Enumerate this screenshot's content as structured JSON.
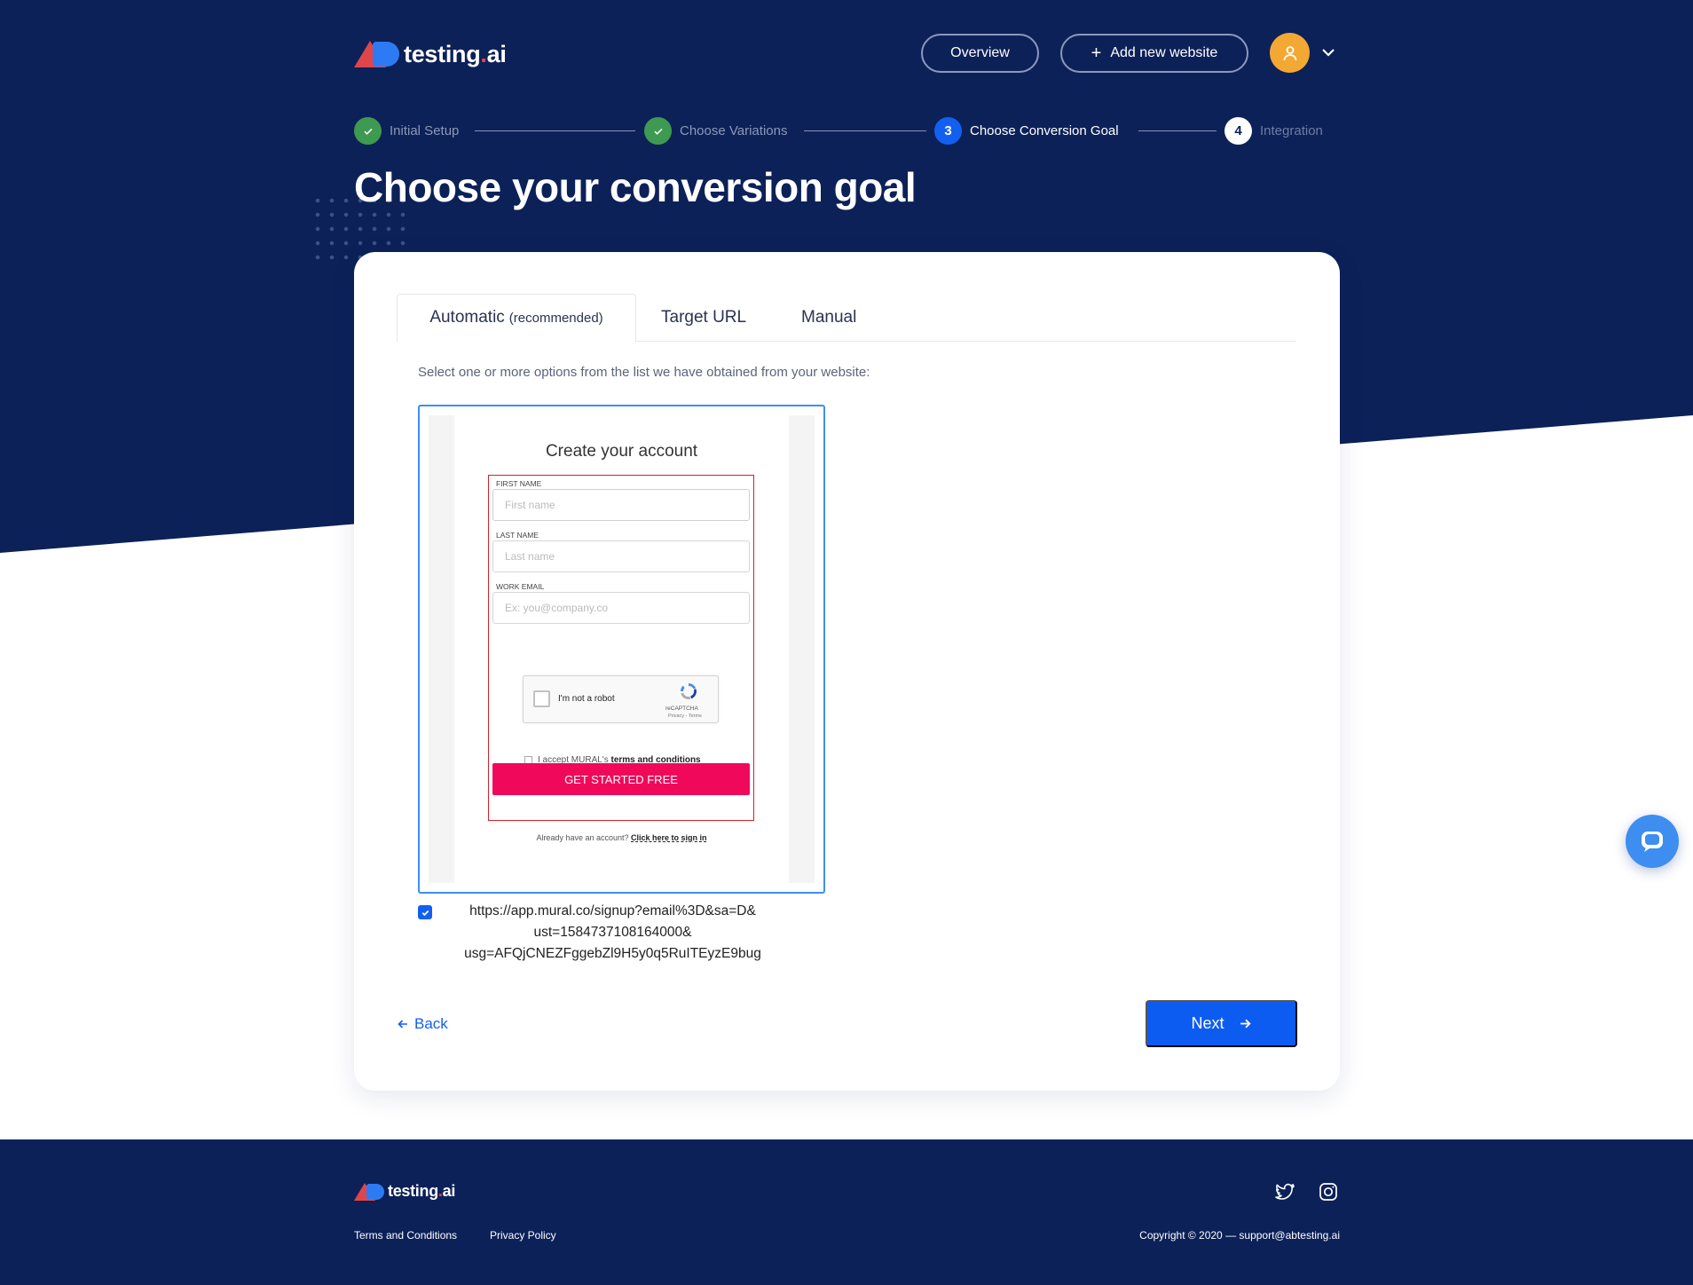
{
  "header": {
    "logo_text": "testing",
    "logo_dot": ".",
    "logo_suffix": "ai",
    "overview_label": "Overview",
    "add_site_label": "Add new website"
  },
  "stepper": {
    "steps": [
      {
        "label": "Initial Setup",
        "state": "done"
      },
      {
        "label": "Choose Variations",
        "state": "done"
      },
      {
        "label": "Choose Conversion Goal",
        "state": "active",
        "number": "3"
      },
      {
        "label": "Integration",
        "state": "todo",
        "number": "4"
      }
    ]
  },
  "page": {
    "title": "Choose your conversion goal"
  },
  "tabs": {
    "automatic_label": "Automatic",
    "automatic_hint": "(recommended)",
    "target_url_label": "Target URL",
    "manual_label": "Manual"
  },
  "instructions": "Select one or more options from the list we have obtained from your website:",
  "preview": {
    "title": "Create your account",
    "first_name_label": "FIRST NAME",
    "first_name_placeholder": "First name",
    "last_name_label": "LAST NAME",
    "last_name_placeholder": "Last name",
    "work_email_label": "WORK EMAIL",
    "work_email_placeholder": "Ex: you@company.co",
    "captcha_text": "I'm not a robot",
    "captcha_brand": "reCAPTCHA",
    "captcha_links": "Privacy - Terms",
    "accept_prefix": "I accept MURAL's",
    "accept_link": "terms and conditions",
    "cta_label": "GET STARTED FREE",
    "signin_prefix": "Already have an account?",
    "signin_link": "Click here to sign in"
  },
  "option": {
    "checked": true,
    "url_line1": "https://app.mural.co/signup?email%3D&sa=D&",
    "url_line2": "ust=1584737108164000&",
    "url_line3": "usg=AFQjCNEZFggebZl9H5y0q5RuITEyzE9bug"
  },
  "nav": {
    "back_label": "Back",
    "next_label": "Next"
  },
  "footer": {
    "logo_text": "testing",
    "logo_dot": ".",
    "logo_suffix": "ai",
    "terms_label": "Terms and Conditions",
    "privacy_label": "Privacy Policy",
    "copyright": "Copyright © 2020 — support@abtesting.ai"
  },
  "icons": {
    "twitter": "twitter-icon",
    "instagram": "instagram-icon",
    "chat": "chat-icon"
  },
  "colors": {
    "navy": "#0c2158",
    "primary": "#1360f0",
    "success": "#3d9a50",
    "avatar": "#f3a833",
    "cta_pink": "#f0095a"
  }
}
